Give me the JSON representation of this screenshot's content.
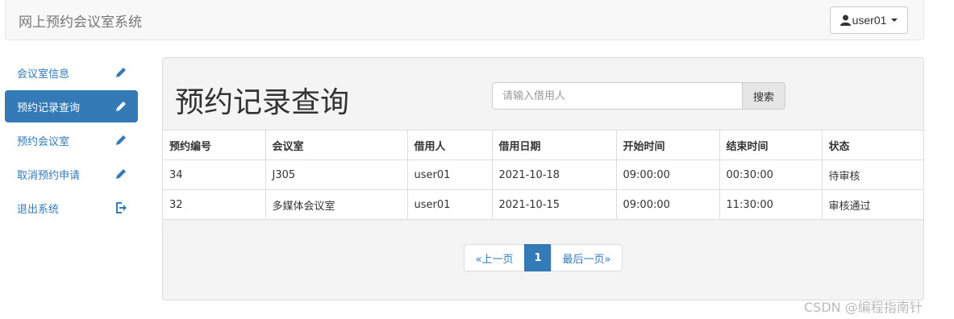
{
  "navbar": {
    "brand": "网上预约会议室系统",
    "user_label": "user01",
    "user_icon": "user-icon"
  },
  "sidebar": {
    "items": [
      {
        "label": "会议室信息",
        "icon": "pencil-icon",
        "active": false
      },
      {
        "label": "预约记录查询",
        "icon": "pencil-icon",
        "active": true
      },
      {
        "label": "预约会议室",
        "icon": "pencil-icon",
        "active": false
      },
      {
        "label": "取消预约申请",
        "icon": "pencil-icon",
        "active": false
      },
      {
        "label": "退出系统",
        "icon": "logout-icon",
        "active": false
      }
    ]
  },
  "main": {
    "title": "预约记录查询",
    "search": {
      "placeholder": "请输入借用人",
      "value": "",
      "button_label": "搜索"
    },
    "table": {
      "headers": [
        "预约编号",
        "会议室",
        "借用人",
        "借用日期",
        "开始时间",
        "结束时间",
        "状态"
      ],
      "rows": [
        [
          "34",
          "J305",
          "user01",
          "2021-10-18",
          "09:00:00",
          "00:30:00",
          "待审核"
        ],
        [
          "32",
          "多媒体会议室",
          "user01",
          "2021-10-15",
          "09:00:00",
          "11:30:00",
          "审核通过"
        ]
      ]
    },
    "pagination": {
      "prev_label": "«上一页",
      "current": "1",
      "last_label": "最后一页»"
    }
  },
  "colors": {
    "primary": "#337ab7",
    "navbar_bg": "#f8f8f8",
    "panel_bg": "#f4f4f4"
  },
  "watermark": "CSDN @编程指南针"
}
